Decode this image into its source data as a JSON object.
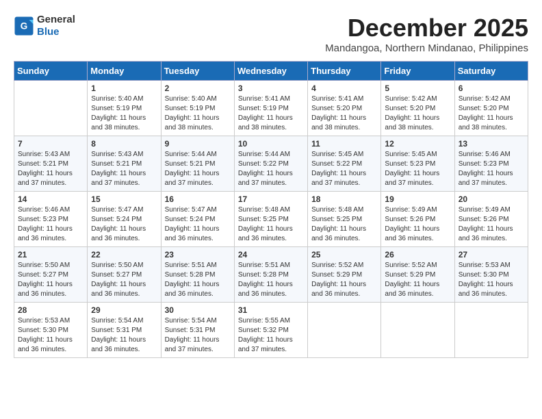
{
  "logo": {
    "text_general": "General",
    "text_blue": "Blue"
  },
  "header": {
    "month_year": "December 2025",
    "location": "Mandangoa, Northern Mindanao, Philippines"
  },
  "weekdays": [
    "Sunday",
    "Monday",
    "Tuesday",
    "Wednesday",
    "Thursday",
    "Friday",
    "Saturday"
  ],
  "weeks": [
    [
      {
        "day": "",
        "info": ""
      },
      {
        "day": "1",
        "info": "Sunrise: 5:40 AM\nSunset: 5:19 PM\nDaylight: 11 hours\nand 38 minutes."
      },
      {
        "day": "2",
        "info": "Sunrise: 5:40 AM\nSunset: 5:19 PM\nDaylight: 11 hours\nand 38 minutes."
      },
      {
        "day": "3",
        "info": "Sunrise: 5:41 AM\nSunset: 5:19 PM\nDaylight: 11 hours\nand 38 minutes."
      },
      {
        "day": "4",
        "info": "Sunrise: 5:41 AM\nSunset: 5:20 PM\nDaylight: 11 hours\nand 38 minutes."
      },
      {
        "day": "5",
        "info": "Sunrise: 5:42 AM\nSunset: 5:20 PM\nDaylight: 11 hours\nand 38 minutes."
      },
      {
        "day": "6",
        "info": "Sunrise: 5:42 AM\nSunset: 5:20 PM\nDaylight: 11 hours\nand 38 minutes."
      }
    ],
    [
      {
        "day": "7",
        "info": "Sunrise: 5:43 AM\nSunset: 5:21 PM\nDaylight: 11 hours\nand 37 minutes."
      },
      {
        "day": "8",
        "info": "Sunrise: 5:43 AM\nSunset: 5:21 PM\nDaylight: 11 hours\nand 37 minutes."
      },
      {
        "day": "9",
        "info": "Sunrise: 5:44 AM\nSunset: 5:21 PM\nDaylight: 11 hours\nand 37 minutes."
      },
      {
        "day": "10",
        "info": "Sunrise: 5:44 AM\nSunset: 5:22 PM\nDaylight: 11 hours\nand 37 minutes."
      },
      {
        "day": "11",
        "info": "Sunrise: 5:45 AM\nSunset: 5:22 PM\nDaylight: 11 hours\nand 37 minutes."
      },
      {
        "day": "12",
        "info": "Sunrise: 5:45 AM\nSunset: 5:23 PM\nDaylight: 11 hours\nand 37 minutes."
      },
      {
        "day": "13",
        "info": "Sunrise: 5:46 AM\nSunset: 5:23 PM\nDaylight: 11 hours\nand 37 minutes."
      }
    ],
    [
      {
        "day": "14",
        "info": "Sunrise: 5:46 AM\nSunset: 5:23 PM\nDaylight: 11 hours\nand 36 minutes."
      },
      {
        "day": "15",
        "info": "Sunrise: 5:47 AM\nSunset: 5:24 PM\nDaylight: 11 hours\nand 36 minutes."
      },
      {
        "day": "16",
        "info": "Sunrise: 5:47 AM\nSunset: 5:24 PM\nDaylight: 11 hours\nand 36 minutes."
      },
      {
        "day": "17",
        "info": "Sunrise: 5:48 AM\nSunset: 5:25 PM\nDaylight: 11 hours\nand 36 minutes."
      },
      {
        "day": "18",
        "info": "Sunrise: 5:48 AM\nSunset: 5:25 PM\nDaylight: 11 hours\nand 36 minutes."
      },
      {
        "day": "19",
        "info": "Sunrise: 5:49 AM\nSunset: 5:26 PM\nDaylight: 11 hours\nand 36 minutes."
      },
      {
        "day": "20",
        "info": "Sunrise: 5:49 AM\nSunset: 5:26 PM\nDaylight: 11 hours\nand 36 minutes."
      }
    ],
    [
      {
        "day": "21",
        "info": "Sunrise: 5:50 AM\nSunset: 5:27 PM\nDaylight: 11 hours\nand 36 minutes."
      },
      {
        "day": "22",
        "info": "Sunrise: 5:50 AM\nSunset: 5:27 PM\nDaylight: 11 hours\nand 36 minutes."
      },
      {
        "day": "23",
        "info": "Sunrise: 5:51 AM\nSunset: 5:28 PM\nDaylight: 11 hours\nand 36 minutes."
      },
      {
        "day": "24",
        "info": "Sunrise: 5:51 AM\nSunset: 5:28 PM\nDaylight: 11 hours\nand 36 minutes."
      },
      {
        "day": "25",
        "info": "Sunrise: 5:52 AM\nSunset: 5:29 PM\nDaylight: 11 hours\nand 36 minutes."
      },
      {
        "day": "26",
        "info": "Sunrise: 5:52 AM\nSunset: 5:29 PM\nDaylight: 11 hours\nand 36 minutes."
      },
      {
        "day": "27",
        "info": "Sunrise: 5:53 AM\nSunset: 5:30 PM\nDaylight: 11 hours\nand 36 minutes."
      }
    ],
    [
      {
        "day": "28",
        "info": "Sunrise: 5:53 AM\nSunset: 5:30 PM\nDaylight: 11 hours\nand 36 minutes."
      },
      {
        "day": "29",
        "info": "Sunrise: 5:54 AM\nSunset: 5:31 PM\nDaylight: 11 hours\nand 36 minutes."
      },
      {
        "day": "30",
        "info": "Sunrise: 5:54 AM\nSunset: 5:31 PM\nDaylight: 11 hours\nand 37 minutes."
      },
      {
        "day": "31",
        "info": "Sunrise: 5:55 AM\nSunset: 5:32 PM\nDaylight: 11 hours\nand 37 minutes."
      },
      {
        "day": "",
        "info": ""
      },
      {
        "day": "",
        "info": ""
      },
      {
        "day": "",
        "info": ""
      }
    ]
  ]
}
